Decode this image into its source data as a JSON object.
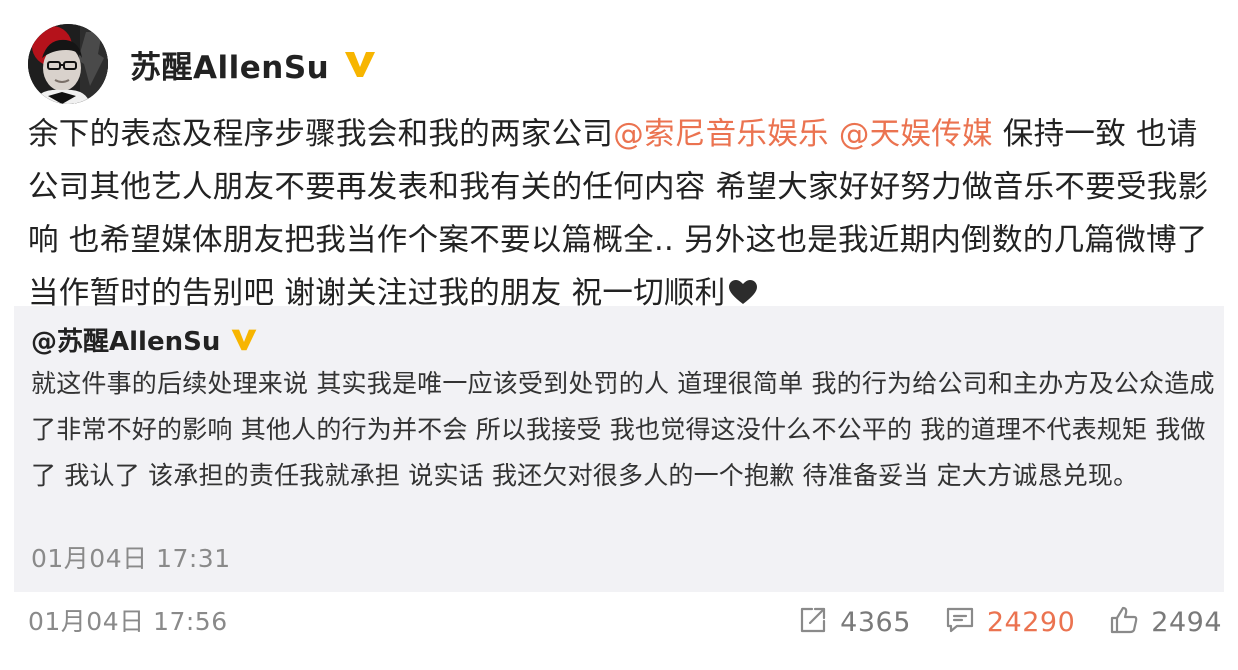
{
  "post": {
    "author": "苏醒AllenSu",
    "text_before": "余下的表态及程序步骤我会和我的两家公司",
    "mention_1": "@索尼音乐娱乐",
    "mention_2": "@天娱传媒",
    "text_after": " 保持一致 也请公司其他艺人朋友不要再发表和我有关的任何内容 希望大家好好努力做音乐不要受我影响 也希望媒体朋友把我当作个案不要以篇概全.. 另外这也是我近期内倒数的几篇微博了 当作暂时的告别吧 谢谢关注过我的朋友 祝一切顺利",
    "time": "01月04日 17:56"
  },
  "repost": {
    "author": "@苏醒AllenSu",
    "text": "就这件事的后续处理来说 其实我是唯一应该受到处罚的人 道理很简单 我的行为给公司和主办方及公众造成了非常不好的影响 其他人的行为并不会 所以我接受 我也觉得这没什么不公平的 我的道理不代表规矩 我做了 我认了 该承担的责任我就承担 说实话 我还欠对很多人的一个抱歉 待准备妥当 定大方诚恳兑现。",
    "time": "01月04日 17:31"
  },
  "actions": {
    "repost_count": "4365",
    "comment_count": "24290",
    "like_count": "2494"
  },
  "icons": {
    "verified": "verified-v-icon",
    "heart": "black-heart-icon",
    "repost": "repost-icon",
    "comment": "comment-icon",
    "like": "thumbs-up-icon"
  },
  "colors": {
    "mention": "#eb7350",
    "verified_badge": "#f7b500",
    "meta_gray": "#8a8a8a",
    "repost_bg": "#f2f2f5"
  }
}
